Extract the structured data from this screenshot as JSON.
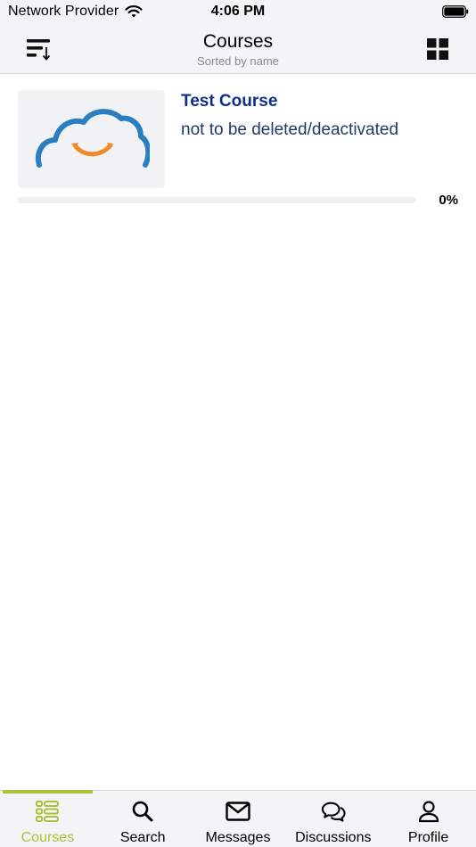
{
  "status_bar": {
    "carrier": "Network Provider",
    "time": "4:06 PM"
  },
  "header": {
    "title": "Courses",
    "subtitle": "Sorted by name",
    "sort_icon": "sort-lines-icon",
    "view_icon": "grid-view-icon"
  },
  "courses": [
    {
      "title": "Test Course",
      "description": "not to be deleted/deactivated",
      "progress_label": "0%",
      "progress": 0,
      "thumbnail_icon": "cloud-smile-logo"
    }
  ],
  "tabs": [
    {
      "label": "Courses",
      "icon": "courses-list-icon",
      "active": true
    },
    {
      "label": "Search",
      "icon": "search-icon",
      "active": false
    },
    {
      "label": "Messages",
      "icon": "envelope-icon",
      "active": false
    },
    {
      "label": "Discussions",
      "icon": "chat-bubbles-icon",
      "active": false
    },
    {
      "label": "Profile",
      "icon": "person-icon",
      "active": false
    }
  ],
  "colors": {
    "accent": "#a8c43a",
    "course_title": "#0f2f8f",
    "course_description": "#1e3a5f",
    "logo_blue": "#2a7fc1",
    "logo_orange": "#f08a2b"
  }
}
